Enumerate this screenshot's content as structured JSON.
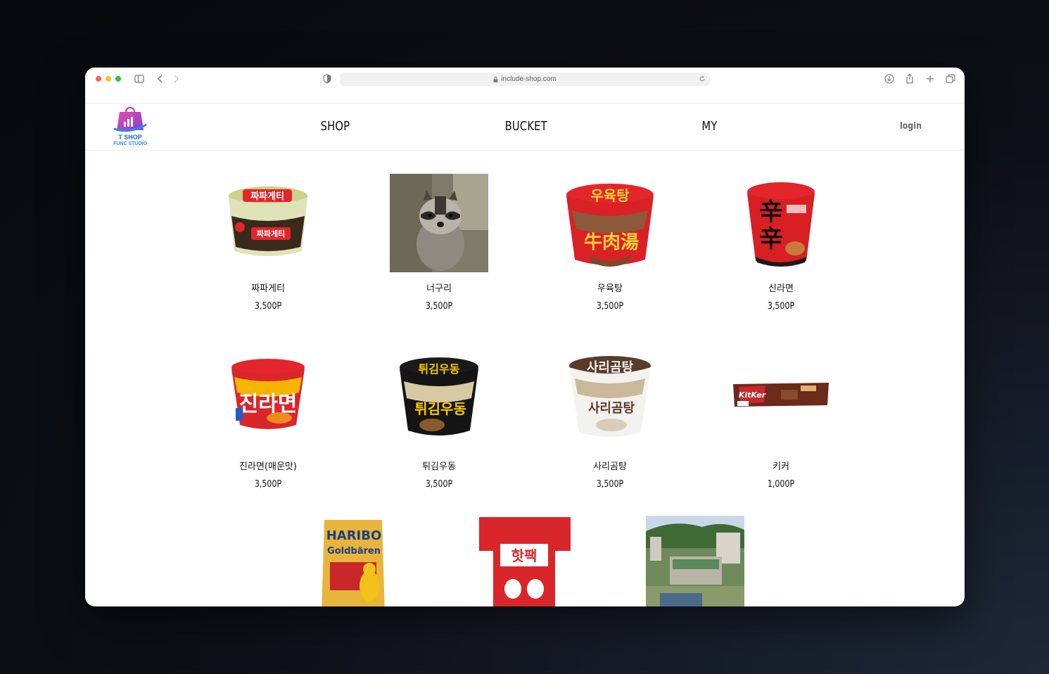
{
  "browser": {
    "url": "include-shop.com"
  },
  "header": {
    "logo": {
      "line1": "T SHOP",
      "line2": "FUNC STUDIO"
    },
    "nav": [
      {
        "label": "SHOP"
      },
      {
        "label": "BUCKET"
      },
      {
        "label": "MY"
      }
    ],
    "login_label": "login"
  },
  "products": [
    {
      "name": "짜파게티",
      "price": "3,500P",
      "image": "ramen-cup-jjapagetti"
    },
    {
      "name": "너구리",
      "price": "3,500P",
      "image": "raccoon-photo"
    },
    {
      "name": "우육탕",
      "price": "3,500P",
      "image": "ramen-cup-uyuktang"
    },
    {
      "name": "신라면",
      "price": "3,500P",
      "image": "ramen-cup-shin"
    },
    {
      "name": "진라면(매운맛)",
      "price": "3,500P",
      "image": "ramen-cup-jin"
    },
    {
      "name": "튀김우동",
      "price": "3,500P",
      "image": "ramen-cup-udon"
    },
    {
      "name": "사리곰탕",
      "price": "3,500P",
      "image": "ramen-cup-sarigomtang"
    },
    {
      "name": "키커",
      "price": "1,000P",
      "image": "chocolate-bar-kicker"
    },
    {
      "name": "",
      "price": "",
      "image": "haribo-goldbaren-bag"
    },
    {
      "name": "",
      "price": "",
      "image": "hotpack-box"
    },
    {
      "name": "",
      "price": "",
      "image": "school-aerial-photo"
    }
  ],
  "colors": {
    "accent_red": "#e3262b",
    "nav_text": "#111111",
    "login_text": "#666666"
  }
}
